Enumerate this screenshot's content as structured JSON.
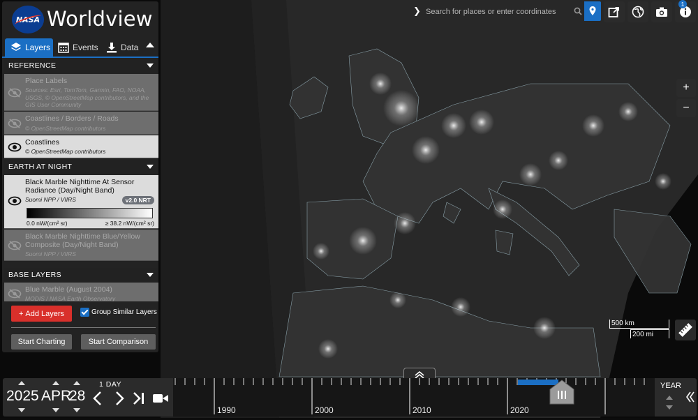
{
  "app": {
    "title": "Worldview",
    "logo_text": "NASA"
  },
  "tabs": [
    {
      "label": "Layers",
      "icon": "layers-icon",
      "active": true
    },
    {
      "label": "Events",
      "icon": "calendar-icon",
      "active": false
    },
    {
      "label": "Data",
      "icon": "download-icon",
      "active": false
    }
  ],
  "categories": {
    "reference": "REFERENCE",
    "night": "EARTH AT NIGHT",
    "base": "BASE LAYERS"
  },
  "layers": {
    "place_labels": {
      "name": "Place Labels",
      "source": "Sources: Esri, TomTom, Garmin, FAO, NOAA, USGS, © OpenStreetMap contributors, and the GIS User Community"
    },
    "coast_borders": {
      "name": "Coastlines / Borders / Roads",
      "source": "© OpenStreetMap contributors"
    },
    "coastlines": {
      "name": "Coastlines",
      "source": "© OpenStreetMap contributors"
    },
    "black_marble": {
      "name": "Black Marble Nighttime At Sensor Radiance (Day/Night Band)",
      "source": "Suomi NPP / VIIRS",
      "badge": "v2.0 NRT",
      "legend_min": "0.0 nW/(cm² sr)",
      "legend_max": "≥ 38.2 nW/(cm² sr)"
    },
    "black_marble_by": {
      "name": "Black Marble Nighttime Blue/Yellow Composite (Day/Night Band)",
      "source": "Suomi NPP / VIIRS"
    },
    "blue_marble": {
      "name": "Blue Marble (August 2004)",
      "source": "MODIS / NASA Earth Observatory"
    }
  },
  "sidebar_actions": {
    "add_layers": "Add Layers",
    "group_similar": "Group Similar Layers",
    "group_checked": true,
    "start_charting": "Start Charting",
    "start_comparison": "Start Comparison"
  },
  "search": {
    "placeholder": "Search for places or enter coordinates"
  },
  "toolbar": {
    "info_count": "1"
  },
  "zoom": {
    "in": "+",
    "out": "−"
  },
  "scale": {
    "km": "500 km",
    "mi": "200 mi"
  },
  "date": {
    "year": "2025",
    "month": "APR",
    "day": "28",
    "interval": "1 DAY"
  },
  "timeline": {
    "ticks": [
      "1990",
      "2000",
      "2010",
      "2020"
    ],
    "zoom_label": "YEAR"
  },
  "colors": {
    "accent": "#1b6fc4",
    "add_button": "#d9302b",
    "panel": "#262626"
  }
}
